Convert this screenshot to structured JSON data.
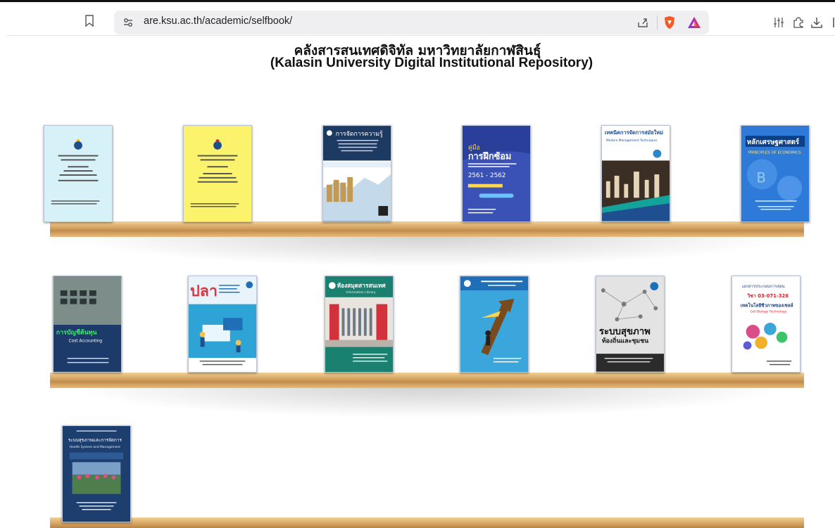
{
  "browser": {
    "url": "are.ksu.ac.th/academic/selfbook/",
    "icons": [
      "bookmark-icon",
      "site-settings-icon",
      "share-icon",
      "brave-shield-icon",
      "brave-rewards-icon",
      "media-controls-icon",
      "extensions-icon",
      "downloads-icon"
    ]
  },
  "page": {
    "title_th": "คลังสารสนเทศดิจิทัล มหาวิทยาลัยกาฬสินธุ์",
    "title_en": "(Kalasin University Digital Institutional Repository)"
  },
  "colors": {
    "shelf": "#d8a764",
    "page_bg": "#ffffff"
  },
  "books": [
    {
      "name": "book-annual-report-2567",
      "cover_color": "#d7f1f8"
    },
    {
      "name": "book-annual-report-2566",
      "cover_color": "#fbf36b"
    },
    {
      "name": "book-knowledge-management",
      "cover_color": "#1d3a63",
      "lines": [
        "การจัดการความรู้"
      ]
    },
    {
      "name": "book-training-manual",
      "cover_color": "#2a3f9a",
      "lines": [
        "คู่มือ",
        "การฝึกซ้อม",
        "2561 - 2562"
      ]
    },
    {
      "name": "book-modern-management-techniques",
      "cover_color": "#ffffff",
      "lines": [
        "เทคนิคการจัดการสมัยใหม่",
        "Modern Management Techniques"
      ]
    },
    {
      "name": "book-principles-of-economics",
      "cover_color": "#1f63b5",
      "lines": [
        "หลักเศรษฐศาสตร์",
        "PRINCIPLES OF ECONOMICS"
      ]
    },
    {
      "name": "book-cost-accounting",
      "cover_color": "#4a6a7a",
      "lines": [
        "การบัญชีต้นทุน",
        "Cost Accounting"
      ]
    },
    {
      "name": "book-fish",
      "cover_color": "#e9f3fb",
      "lines": [
        "ปลา"
      ]
    },
    {
      "name": "book-information-library",
      "cover_color": "#1a8170",
      "lines": [
        "ห้องสมุดสารสนเทศ",
        "Information Library"
      ]
    },
    {
      "name": "book-innovation-management",
      "cover_color": "#3ba6db"
    },
    {
      "name": "book-community-health-system",
      "cover_color": "#dcdcdc",
      "lines": [
        "ระบบสุขภาพ",
        "ท้องถิ่นและชุมชน"
      ]
    },
    {
      "name": "book-cell-biology-technology",
      "cover_color": "#ffffff",
      "lines": [
        "เอกสารประกอบการสอน",
        "วิชา 03-071-326",
        "เทคโนโลยีชีวภาพของเซลล์",
        "Cell Biology Technology"
      ]
    },
    {
      "name": "book-health-system-management",
      "cover_color": "#1c3f70",
      "lines": [
        "ระบบสุขภาพและการจัดการ",
        "Health System and Management"
      ]
    }
  ]
}
